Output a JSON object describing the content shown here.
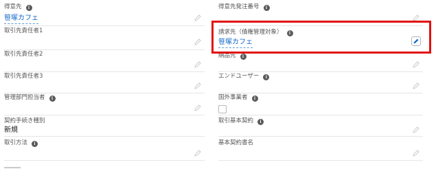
{
  "left_fields": [
    {
      "label": "得意先",
      "info": true,
      "value": "笹塚カフェ",
      "link": true
    },
    {
      "label": "取引先責任者1",
      "info": false,
      "value": ""
    },
    {
      "label": "取引先責任者2",
      "info": false,
      "value": ""
    },
    {
      "label": "取引先責任者3",
      "info": false,
      "value": ""
    },
    {
      "label": "管理部門担当者",
      "info": true,
      "value": ""
    },
    {
      "label": "契約手続き種別",
      "info": false,
      "value": "新規"
    },
    {
      "label": "取引方法",
      "info": true,
      "value": ""
    }
  ],
  "right_fields": [
    {
      "label": "得意先発注番号",
      "info": true,
      "value": ""
    },
    {
      "label": "請求先（債権管理対象）",
      "info": true,
      "value": "笹塚カフェ",
      "link": true
    },
    {
      "label": "納品先",
      "info": true,
      "value": ""
    },
    {
      "label": "エンドユーザー",
      "info": true,
      "value": ""
    },
    {
      "label": "国外事業者",
      "info": true,
      "value": "",
      "checkbox_checked": false
    },
    {
      "label": "取引基本契約",
      "info": true,
      "value": ""
    },
    {
      "label": "基本契約書名",
      "info": false,
      "value": ""
    }
  ],
  "info_glyph": "i",
  "colors": {
    "highlight": "#e20f0f",
    "link": "#0b64c8"
  }
}
